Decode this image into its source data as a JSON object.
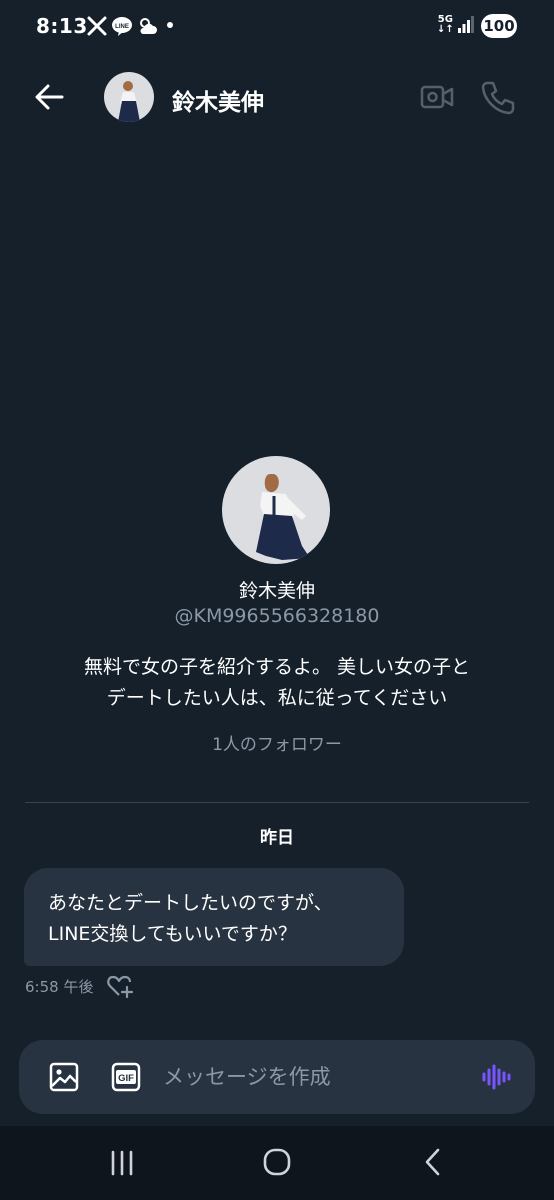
{
  "status_bar": {
    "time": "8:13",
    "network": "5G",
    "battery": "100",
    "icons": [
      "x-logo-icon",
      "line-app-icon",
      "weather-icon",
      "notification-dot-icon",
      "signal-icon"
    ]
  },
  "header": {
    "name": "鈴木美伸",
    "icons": [
      "back-arrow-icon",
      "video-call-icon",
      "phone-icon"
    ]
  },
  "profile": {
    "name": "鈴木美伸",
    "handle": "@KM9965566328180",
    "bio_line1": "無料で女の子を紹介するよ。 美しい女の子と",
    "bio_line2": "デートしたい人は、私に従ってください",
    "followers": "1人のフォロワー"
  },
  "conversation": {
    "day_label": "昨日",
    "messages": [
      {
        "line1": "あなたとデートしたいのですが、",
        "line2": "LINE交換してもいいですか？",
        "time": "6:58 午後"
      }
    ]
  },
  "composer": {
    "placeholder": "メッセージを作成",
    "gif_label": "GIF",
    "icons": [
      "image-icon",
      "gif-icon",
      "voice-message-icon"
    ]
  },
  "nav": {
    "icons": [
      "recent-apps-icon",
      "home-icon",
      "back-icon"
    ]
  },
  "colors": {
    "background": "#15202b",
    "bubble": "#273340",
    "secondary_text": "#8b98a5",
    "accent_voice": "#7856ff"
  }
}
